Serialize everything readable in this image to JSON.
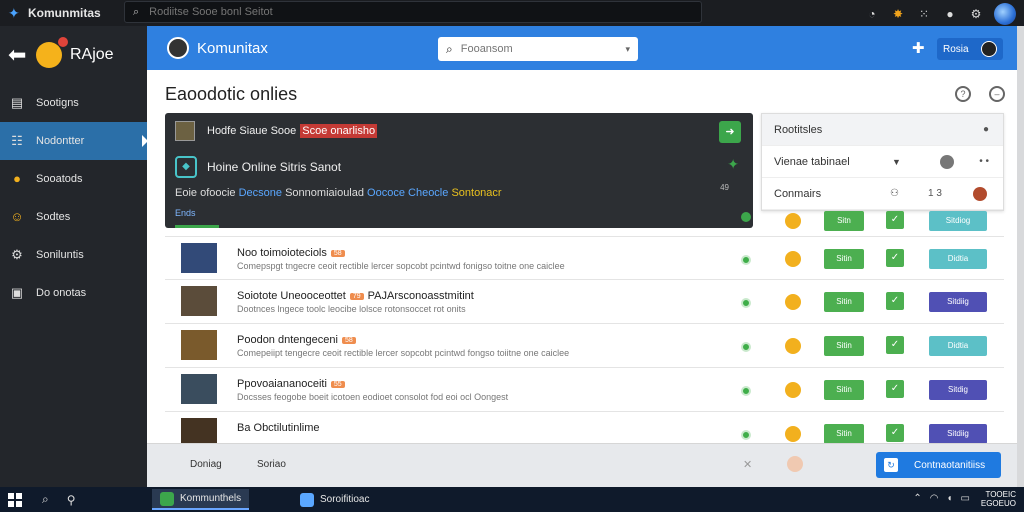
{
  "window": {
    "app_name": "Komunmitas",
    "search_placeholder": "Rodiitse Sooe bonl Seitot"
  },
  "sidebar": {
    "title": "RAjoe",
    "items": [
      {
        "label": "Sootigns",
        "icon": "chart-icon"
      },
      {
        "label": "Nodontter",
        "icon": "group-icon",
        "active": true
      },
      {
        "label": "Sooatods",
        "icon": "emoji-icon"
      },
      {
        "label": "Sodtes",
        "icon": "user-emoji-icon"
      },
      {
        "label": "Soniluntis",
        "icon": "settings-icon"
      },
      {
        "label": "Do onotas",
        "icon": "document-icon"
      }
    ]
  },
  "header": {
    "title": "Komunitax",
    "search_placeholder": "Fooansom",
    "user_label": "Rosia"
  },
  "page": {
    "title": "Eaoodotic onlies"
  },
  "notification": {
    "line1_text": "Hodfe Siaue Sooe",
    "line1_highlight": "Scoe onarlisho",
    "line2_text": "Hoine Online Sitris Sanot",
    "line3_prefix": "Eoie ofoocie",
    "line3_blue": "Decsone",
    "line3_mid": "Sonnomiaioulad",
    "line3_blue2": "Oococe Cheocle",
    "line3_yellow": "Sontonacr",
    "link": "Ends",
    "small_note": "49"
  },
  "right_panel": {
    "rows": [
      {
        "label": "Rootitsles"
      },
      {
        "label": "Vienae tabinael"
      },
      {
        "label": "Conmairs",
        "count": "1 3"
      }
    ]
  },
  "list": {
    "rows": [
      {
        "title": "Noo toimoioteciols",
        "tag": "58",
        "subtitle": "Comepspgt tngecre ceoit rectible lercer sopcobt pcintwd fonigso toitne one caiclee",
        "action": "Didtia",
        "action_color": "teal",
        "thumb_color": "#324a78"
      },
      {
        "title": "Soiotote Uneooceottet",
        "tag": "79",
        "subtitle": "Dootnces lngece toolc leocibe lolsce rotonsoccet rot onits",
        "extra": "PAJArsconoasstmitint",
        "action": "Sitdiig",
        "action_color": "purple",
        "thumb_color": "#5b4c3a"
      },
      {
        "title": "Poodon dntengeceni",
        "tag": "58",
        "subtitle": "Comepeiipt tengecre ceoit rectible lercer sopcobt pcintwd fongso toiitne one caiclee",
        "action": "Didtia",
        "action_color": "teal",
        "thumb_color": "#7a5a2c"
      },
      {
        "title": "Ppovoaiananoceiti",
        "tag": "55",
        "subtitle": "Docsses feogobe boeit icotoen eodioet consolot fod eoi ocl Oongest",
        "action": "Sitdig",
        "action_color": "purple",
        "thumb_color": "#3a4d5e"
      },
      {
        "title": "Ba Obctilutinlime",
        "tag": "",
        "subtitle": "",
        "action": "Sitdiig",
        "action_color": "purple",
        "thumb_color": "#443322"
      }
    ],
    "row_button_label": "Sitin"
  },
  "peek_row": {
    "action": "Sitdiog",
    "button_label": "Sitn"
  },
  "footer": {
    "tab1": "Doniag",
    "tab2": "Soriao",
    "primary": "Contnaotanitiiss"
  },
  "taskbar": {
    "apps": [
      {
        "label": "Kommunthels",
        "active": true
      },
      {
        "label": "Soroifitioac",
        "active": false
      }
    ],
    "clock_time": "TOOEIC",
    "clock_date": "EGOEUO"
  },
  "colors": {
    "header_blue": "#2f80e0",
    "sidebar_active": "#2b6fa8",
    "green": "#4caf50",
    "teal": "#5cc0c7",
    "purple": "#5050b4",
    "highlight_red": "#c43a35"
  }
}
